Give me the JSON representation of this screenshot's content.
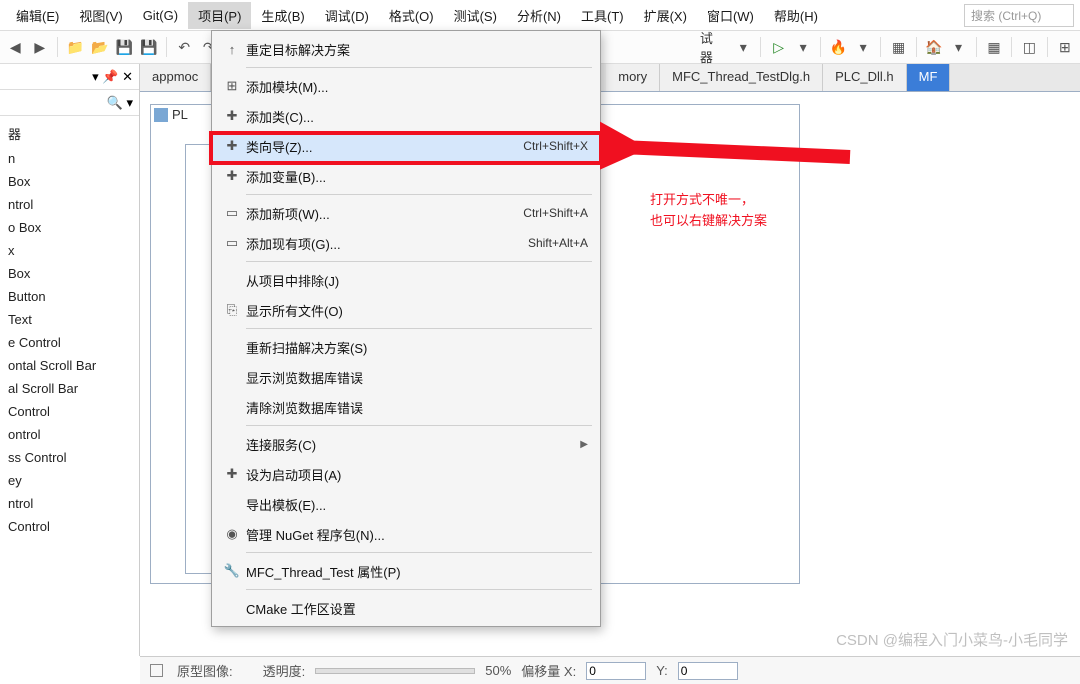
{
  "menubar": {
    "items": [
      "编辑(E)",
      "视图(V)",
      "Git(G)",
      "项目(P)",
      "生成(B)",
      "调试(D)",
      "格式(O)",
      "测试(S)",
      "分析(N)",
      "工具(T)",
      "扩展(X)",
      "窗口(W)",
      "帮助(H)"
    ],
    "active_index": 3,
    "search_placeholder": "搜索 (Ctrl+Q)"
  },
  "toolbar": {
    "after_menu_text": "试器",
    "play": "▷",
    "flame": "🔥"
  },
  "sidepanel": {
    "pin_icon": "📌",
    "close_icon": "✕",
    "dropdown_icon": "▾",
    "search_icon": "🔍",
    "header_tail": "▾ 📌 ✕",
    "items": [
      "器",
      "n",
      "Box",
      "ntrol",
      "o Box",
      "x",
      "Box",
      "Button",
      "Text",
      "e Control",
      "ontal Scroll Bar",
      "al Scroll Bar",
      "Control",
      "ontrol",
      "ss Control",
      "ey",
      "ntrol",
      "Control"
    ]
  },
  "tabs": {
    "items": [
      "appmoc",
      "mory",
      "MFC_Thread_TestDlg.h",
      "PLC_Dll.h",
      "MF"
    ],
    "active_index": 4,
    "preview_label": "PL"
  },
  "dropdown": {
    "groups": [
      [
        {
          "icon": "↑",
          "label": "重定目标解决方案",
          "shortcut": "",
          "arrow": false
        }
      ],
      [
        {
          "icon": "⊞",
          "label": "添加模块(M)...",
          "shortcut": "",
          "arrow": false
        },
        {
          "icon": "✚",
          "label": "添加类(C)...",
          "shortcut": "",
          "arrow": false
        },
        {
          "icon": "✚",
          "label": "类向导(Z)...",
          "shortcut": "Ctrl+Shift+X",
          "arrow": false,
          "highlight": true
        },
        {
          "icon": "✚",
          "label": "添加变量(B)...",
          "shortcut": "",
          "arrow": false
        }
      ],
      [
        {
          "icon": "▭",
          "label": "添加新项(W)...",
          "shortcut": "Ctrl+Shift+A",
          "arrow": false
        },
        {
          "icon": "▭",
          "label": "添加现有项(G)...",
          "shortcut": "Shift+Alt+A",
          "arrow": false
        }
      ],
      [
        {
          "icon": "",
          "label": "从项目中排除(J)",
          "shortcut": "",
          "arrow": false
        },
        {
          "icon": "⎘",
          "label": "显示所有文件(O)",
          "shortcut": "",
          "arrow": false
        }
      ],
      [
        {
          "icon": "",
          "label": "重新扫描解决方案(S)",
          "shortcut": "",
          "arrow": false
        },
        {
          "icon": "",
          "label": "显示浏览数据库错误",
          "shortcut": "",
          "arrow": false
        },
        {
          "icon": "",
          "label": "清除浏览数据库错误",
          "shortcut": "",
          "arrow": false
        }
      ],
      [
        {
          "icon": "",
          "label": "连接服务(C)",
          "shortcut": "",
          "arrow": true
        },
        {
          "icon": "✚",
          "label": "设为启动项目(A)",
          "shortcut": "",
          "arrow": false
        },
        {
          "icon": "",
          "label": "导出模板(E)...",
          "shortcut": "",
          "arrow": false
        },
        {
          "icon": "◉",
          "label": "管理 NuGet 程序包(N)...",
          "shortcut": "",
          "arrow": false
        }
      ],
      [
        {
          "icon": "🔧",
          "label": "MFC_Thread_Test 属性(P)",
          "shortcut": "",
          "arrow": false
        }
      ],
      [
        {
          "icon": "",
          "label": "CMake 工作区设置",
          "shortcut": "",
          "arrow": false
        }
      ]
    ]
  },
  "annotation": {
    "line1": "打开方式不唯一，",
    "line2": "也可以右键解决方案"
  },
  "statusbar": {
    "proto_label": "原型图像:",
    "opacity_label": "透明度:",
    "opacity_value": "50%",
    "offset_x_label": "偏移量 X:",
    "offset_x_value": "0",
    "offset_y_label": "Y:",
    "offset_y_value": "0"
  },
  "watermark": "CSDN @编程入门小菜鸟-小毛同学"
}
